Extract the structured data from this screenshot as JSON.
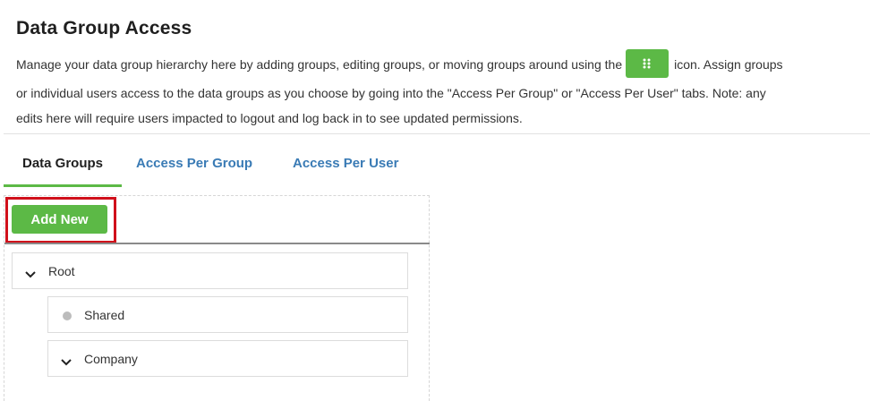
{
  "header": {
    "title": "Data Group Access",
    "description_part1": "Manage your data group hierarchy here by adding groups, editing groups, or moving groups around using the",
    "description_part2": "icon. Assign groups",
    "description_line2": "or individual users access to the data groups as you choose by going into the \"Access Per Group\" or \"Access Per User\" tabs. Note: any",
    "description_line3": "edits here will require users impacted to logout and log back in to see updated permissions.",
    "inline_icon": "grip-dots-icon"
  },
  "tabs": [
    {
      "label": "Data Groups",
      "active": true
    },
    {
      "label": "Access Per Group",
      "active": false
    },
    {
      "label": "Access Per User",
      "active": false
    }
  ],
  "toolbar": {
    "add_label": "Add New"
  },
  "tree": [
    {
      "label": "Root",
      "icon": "chevron-down-icon",
      "level": 0
    },
    {
      "label": "Shared",
      "icon": "dot-icon",
      "level": 1
    },
    {
      "label": "Company",
      "icon": "chevron-down-icon",
      "level": 1
    }
  ],
  "colors": {
    "accent_green": "#5cb946",
    "link_blue": "#3a7bb5",
    "highlight_red": "#d0101b"
  }
}
